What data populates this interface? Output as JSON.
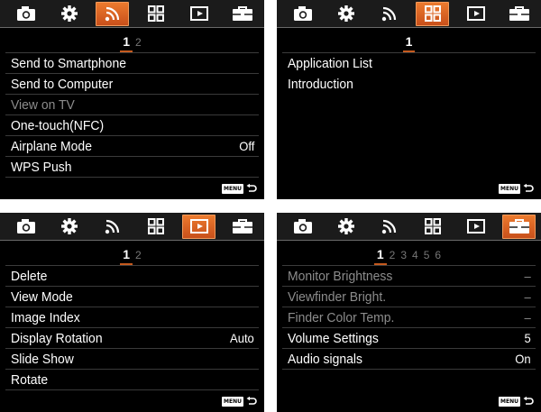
{
  "screens": [
    {
      "active_tab": 2,
      "pages": [
        "1",
        "2"
      ],
      "current_page": 0,
      "items": [
        {
          "label": "Send to Smartphone",
          "value": "",
          "dim": false
        },
        {
          "label": "Send to Computer",
          "value": "",
          "dim": false
        },
        {
          "label": "View on TV",
          "value": "",
          "dim": true
        },
        {
          "label": "One-touch(NFC)",
          "value": "",
          "dim": false
        },
        {
          "label": "Airplane Mode",
          "value": "Off",
          "dim": false
        },
        {
          "label": "WPS Push",
          "value": "",
          "dim": false
        }
      ]
    },
    {
      "active_tab": 3,
      "pages": [
        "1"
      ],
      "current_page": 0,
      "items": [
        {
          "label": "Application List",
          "value": "",
          "dim": false
        },
        {
          "label": "Introduction",
          "value": "",
          "dim": false
        }
      ]
    },
    {
      "active_tab": 4,
      "pages": [
        "1",
        "2"
      ],
      "current_page": 0,
      "items": [
        {
          "label": "Delete",
          "value": "",
          "dim": false
        },
        {
          "label": "View Mode",
          "value": "",
          "dim": false
        },
        {
          "label": "Image Index",
          "value": "",
          "dim": false
        },
        {
          "label": "Display Rotation",
          "value": "Auto",
          "dim": false
        },
        {
          "label": "Slide Show",
          "value": "",
          "dim": false
        },
        {
          "label": "Rotate",
          "value": "",
          "dim": false
        }
      ]
    },
    {
      "active_tab": 5,
      "pages": [
        "1",
        "2",
        "3",
        "4",
        "5",
        "6"
      ],
      "current_page": 0,
      "items": [
        {
          "label": "Monitor Brightness",
          "value": "–",
          "dim": true
        },
        {
          "label": "Viewfinder Bright.",
          "value": "–",
          "dim": true
        },
        {
          "label": "Finder Color Temp.",
          "value": "–",
          "dim": true
        },
        {
          "label": "Volume Settings",
          "value": "5",
          "dim": false
        },
        {
          "label": "Audio signals",
          "value": "On",
          "dim": false
        }
      ]
    }
  ],
  "tabs": [
    "camera-icon",
    "gear-icon",
    "wireless-icon",
    "application-icon",
    "playback-icon",
    "toolbox-icon"
  ],
  "footer": {
    "menu_label": "MENU"
  },
  "colors": {
    "active_tab": "#e06a28",
    "background": "#000000",
    "tabbar": "#1b1b1b",
    "dim_text": "#8c8c8c"
  }
}
